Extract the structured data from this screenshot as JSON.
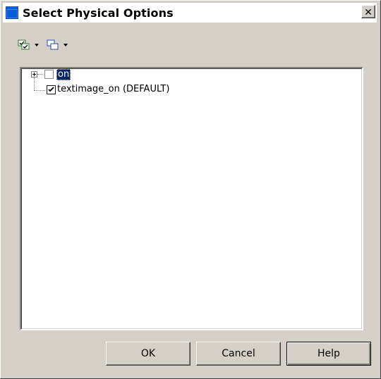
{
  "window": {
    "title": "Select Physical Options",
    "close_symbol": "✕"
  },
  "toolbar": {
    "buttons": [
      {
        "icon": "select-all-icon",
        "has_dropdown": true
      },
      {
        "icon": "deselect-all-icon",
        "has_dropdown": true
      }
    ]
  },
  "tree": {
    "items": [
      {
        "label": "on",
        "checked": false,
        "selected": true,
        "expandable": true
      },
      {
        "label": "textimage_on (DEFAULT)",
        "checked": true,
        "selected": false,
        "expandable": false
      }
    ]
  },
  "buttons": {
    "ok": "OK",
    "cancel": "Cancel",
    "help": "Help"
  },
  "colors": {
    "dialog_background": "#d4d0c8",
    "selection_background": "#0a246a",
    "title_icon": "#0a5bd6"
  }
}
